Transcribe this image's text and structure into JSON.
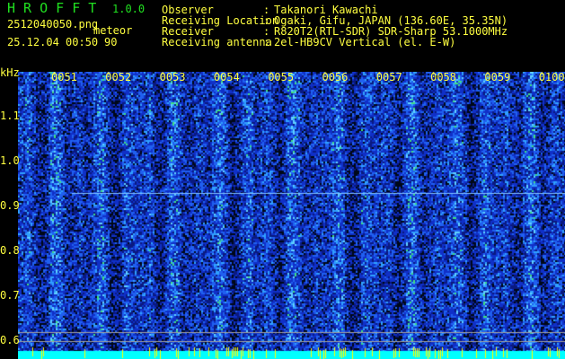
{
  "header": {
    "app_name": "H R O F F T",
    "version": "1.0.0",
    "filename": "2512040050.png",
    "datetime": "25.12.04 00:50",
    "mode_label": "meteor",
    "count": "90",
    "info": [
      {
        "label": "Observer",
        "value": "Takanori Kawachi"
      },
      {
        "label": "Receiving Location",
        "value": "Ogaki, Gifu, JAPAN (136.60E, 35.35N)"
      },
      {
        "label": "Receiver",
        "value": "R820T2(RTL-SDR) SDR-Sharp 53.1000MHz"
      },
      {
        "label": "Receiving antenna",
        "value": "2el-HB9CV Vertical (el. E-W)"
      }
    ]
  },
  "spectrogram": {
    "y_unit": "kHz",
    "y_ticks": [
      "1.1",
      "1.0",
      "0.9",
      "0.8",
      "0.7",
      "0.6"
    ],
    "time_labels": [
      "0051",
      "0052",
      "0053",
      "0054",
      "0055",
      "0056",
      "0057",
      "0058",
      "0059",
      "0100"
    ],
    "colors": {
      "text": "#ffff40",
      "title": "#20e020",
      "background_noise": "#1030c0",
      "signal_bar": "#00ffff",
      "meteor_spikes": "#ffff00",
      "reference_lines": "#a0a0a0"
    }
  }
}
